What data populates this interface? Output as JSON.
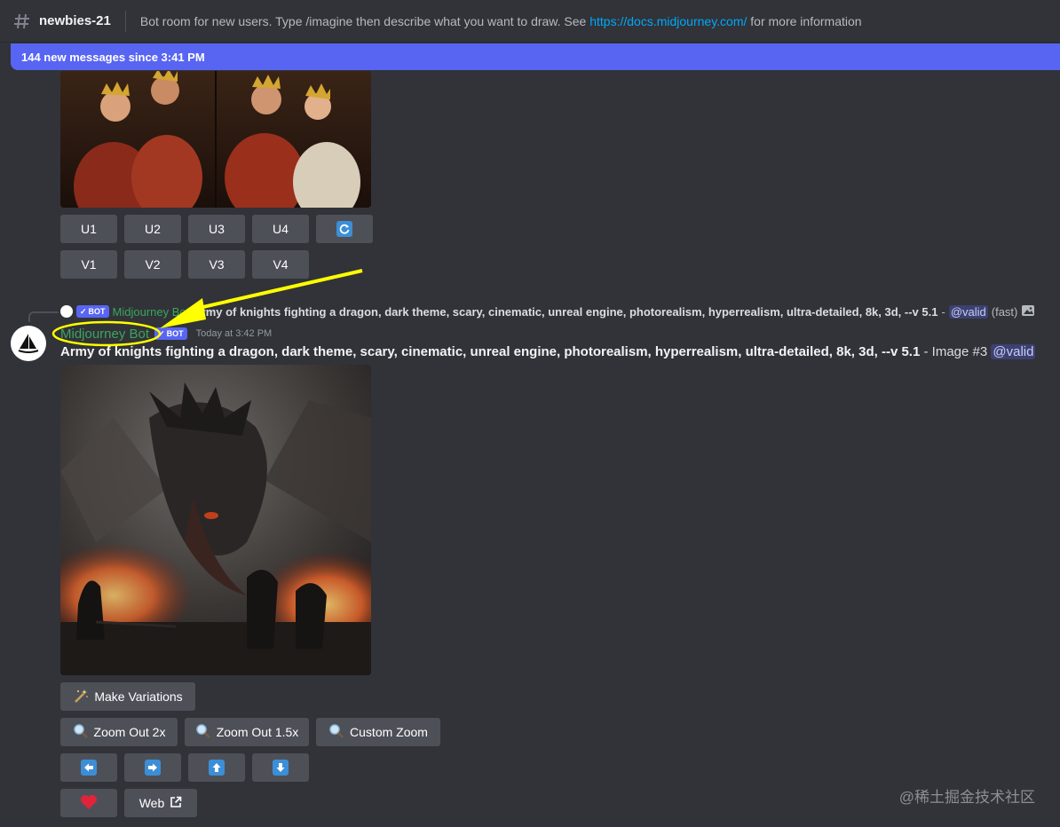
{
  "header": {
    "channel_name": "newbies-21",
    "topic_text": "Bot room for new users. Type /imagine then describe what you want to draw. See ",
    "topic_link": "https://docs.midjourney.com/",
    "topic_suffix": " for more information"
  },
  "banner": {
    "new_messages": "144 new messages since 3:41 PM"
  },
  "prev_message": {
    "upscale_buttons": [
      "U1",
      "U2",
      "U3",
      "U4"
    ],
    "variation_buttons": [
      "V1",
      "V2",
      "V3",
      "V4"
    ],
    "reroll_icon": "refresh-icon"
  },
  "reply": {
    "badge": "BOT",
    "name": "Midjourney Bot",
    "text": "Army of knights fighting a dragon, dark theme, scary, cinematic, unreal engine, photorealism, hyperrealism, ultra-detailed, 8k, 3d, --v 5.1",
    "dash": " - ",
    "mention": "@valid",
    "mode": "(fast)"
  },
  "message": {
    "username": "Midjourney Bot",
    "badge": "BOT",
    "timestamp": "Today at 3:42 PM",
    "prompt": "Army of knights fighting a dragon, dark theme, scary, cinematic, unreal engine, photorealism, hyperrealism, ultra-detailed, 8k, 3d, --v 5.1",
    "image_suffix": " - Image #3 ",
    "mention": "@valid"
  },
  "actions": {
    "make_variations": "Make Variations",
    "zoom_out_2x": "Zoom Out 2x",
    "zoom_out_15x": "Zoom Out 1.5x",
    "custom_zoom": "Custom Zoom",
    "web": "Web",
    "pan_icons": [
      "arrow-left-icon",
      "arrow-right-icon",
      "arrow-up-icon",
      "arrow-down-icon"
    ]
  },
  "watermark": "@稀土掘金技术社区",
  "colors": {
    "background": "#313338",
    "button": "#4e5058",
    "blurple": "#5865f2",
    "bot_name_green": "#3ba55c",
    "link_blue": "#00a8fc",
    "annotation_yellow": "#ffff00"
  }
}
